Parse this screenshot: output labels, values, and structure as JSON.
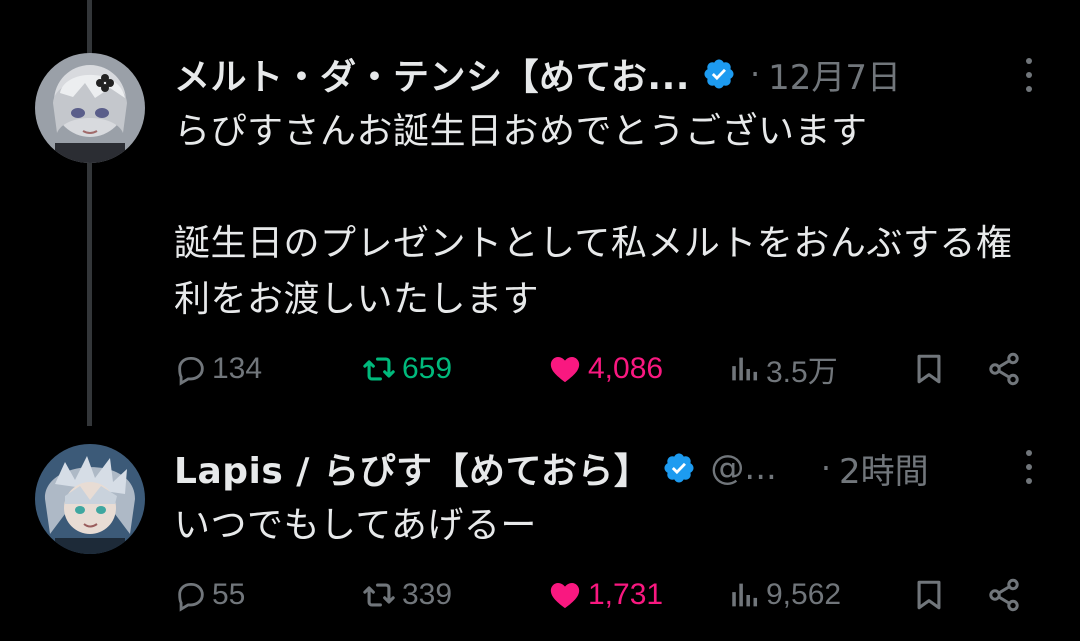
{
  "colors": {
    "background": "#000000",
    "text": "#e7e9ea",
    "muted": "#71767b",
    "verified": "#1d9bf0",
    "repost_active": "#00ba7c",
    "like_active": "#f91880"
  },
  "tweets": [
    {
      "display_name": "メルト・ダ・テンシ【めてお...",
      "handle": "",
      "separator": "·",
      "time": "12月7日",
      "paragraphs": [
        "らぴすさんお誕生日おめでとうございます",
        "",
        "誕生日のプレゼントとして私メルトをおんぶする権利をお渡しいたします"
      ],
      "actions": {
        "replies": "134",
        "reposts": "659",
        "likes": "4,086",
        "views": "3.5万"
      },
      "reposted": true,
      "liked": true,
      "icons": [
        "reply-icon",
        "repost-icon",
        "heart-icon",
        "views-icon",
        "bookmark-icon",
        "share-icon",
        "more-icon",
        "verified-icon"
      ]
    },
    {
      "display_name": "Lapis / らぴす【めておら】",
      "handle": "@...",
      "separator": "·",
      "time": "2時間",
      "paragraphs": [
        "いつでもしてあげるー"
      ],
      "actions": {
        "replies": "55",
        "reposts": "339",
        "likes": "1,731",
        "views": "9,562"
      },
      "reposted": false,
      "liked": true,
      "icons": [
        "reply-icon",
        "repost-icon",
        "heart-icon",
        "views-icon",
        "bookmark-icon",
        "share-icon",
        "more-icon",
        "verified-icon"
      ]
    }
  ]
}
